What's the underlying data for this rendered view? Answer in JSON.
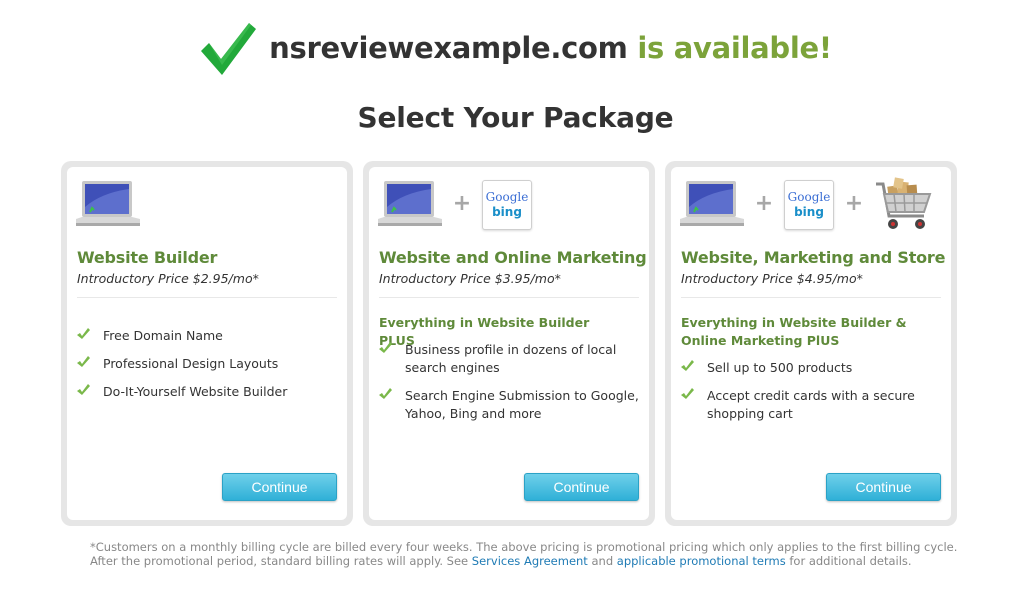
{
  "header": {
    "domain": "nsreviewexample.com",
    "status": " is available!",
    "colors": {
      "check": "#22a93a",
      "status": "#7ca33a"
    }
  },
  "section_title": "Select Your Package",
  "packages": [
    {
      "title": "Website Builder",
      "price": "Introductory Price $2.95/mo*",
      "features_heading": "",
      "features": [
        "Free Domain Name",
        "Professional Design Layouts",
        "Do-It-Yourself Website Builder"
      ],
      "button": "Continue"
    },
    {
      "title": "Website and Online Marketing",
      "price": "Introductory Price $3.95/mo*",
      "features_heading": "Everything in Website Builder PLUS",
      "features": [
        "Business profile in dozens of local search engines",
        "Search Engine Submission to Google, Yahoo, Bing and more"
      ],
      "button": "Continue"
    },
    {
      "title": "Website, Marketing and Store",
      "price": "Introductory Price $4.95/mo*",
      "features_heading": "Everything in Website Builder & Online Marketing PlUS",
      "features": [
        "Sell up to 500 products",
        "Accept credit cards with a secure shopping cart"
      ],
      "button": "Continue"
    }
  ],
  "icons": {
    "plus": "+",
    "google": "Google",
    "bing": "bing"
  },
  "footnote": {
    "line1": "*Customers on a monthly billing cycle are billed every four weeks. The above pricing is promotional pricing which only applies to the first billing cycle.",
    "line2_pre": "After the promotional period, standard billing rates will apply. See ",
    "link1": "Services Agreement",
    "mid": " and ",
    "link2": "applicable promotional terms",
    "post": " for additional details."
  }
}
